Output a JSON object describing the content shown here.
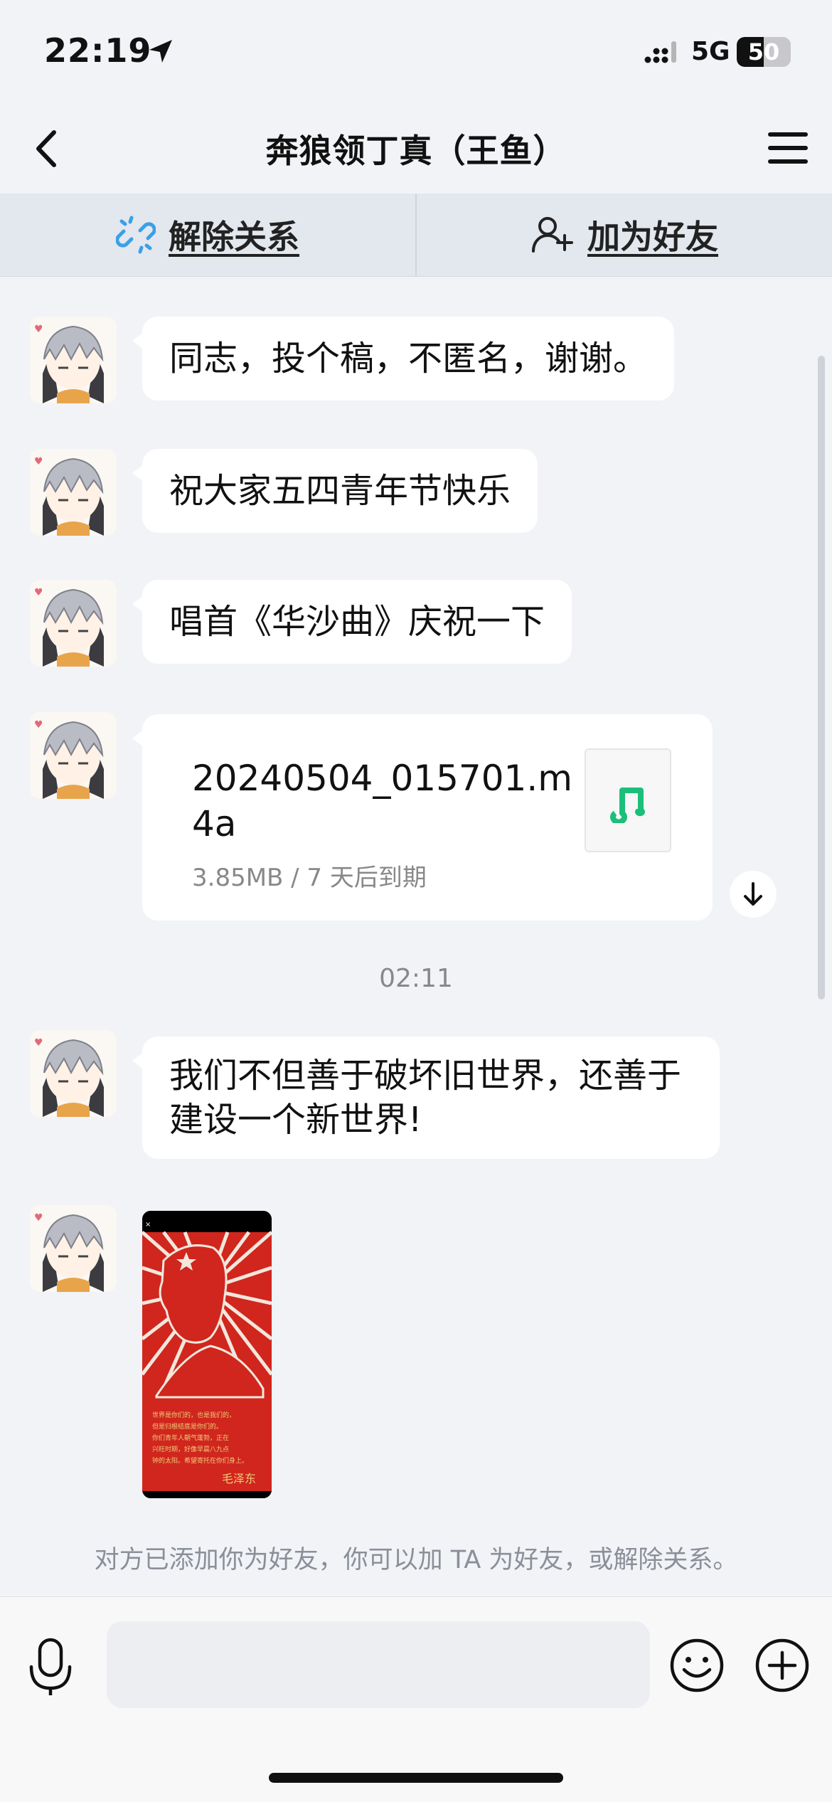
{
  "status_bar": {
    "time": "22:19",
    "network": "5G",
    "battery_level": "50"
  },
  "nav": {
    "title": "奔狼领丁真（王鱼）"
  },
  "relation_bar": {
    "unlink_label": "解除关系",
    "add_friend_label": "加为好友"
  },
  "messages": [
    {
      "type": "text",
      "text": "同志，投个稿，不匿名，谢谢。"
    },
    {
      "type": "text",
      "text": "祝大家五四青年节快乐"
    },
    {
      "type": "text",
      "text": "唱首《华沙曲》庆祝一下"
    },
    {
      "type": "file",
      "filename": "20240504_015701.m4a",
      "meta": "3.85MB / 7 天后到期"
    },
    {
      "type": "text",
      "text": "我们不但善于破坏旧世界，还善于建设一个新世界!"
    },
    {
      "type": "image",
      "signature": "毛泽东"
    }
  ],
  "timestamp": "02:11",
  "notice": "对方已添加你为好友，你可以加 TA 为好友，或解除关系。",
  "icons": [
    "location-arrow-icon",
    "signal-icon",
    "back-icon",
    "menu-icon",
    "unlink-icon",
    "add-friend-icon",
    "music-file-icon",
    "download-icon",
    "voice-icon",
    "emoji-icon",
    "plus-icon"
  ],
  "colors": {
    "unlink_icon": "#3aa0e8",
    "music_icon": "#1bbf7a",
    "poster_red": "#d0261d"
  }
}
